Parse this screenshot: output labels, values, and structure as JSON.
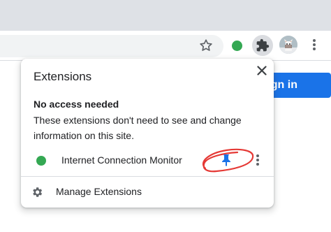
{
  "popup": {
    "title": "Extensions",
    "section_heading": "No access needed",
    "section_description": "These extensions don't need to see and change information on this site.",
    "extensions": [
      {
        "name": "Internet Connection Monitor",
        "icon": "green-dot-icon",
        "icon_color": "#34a853",
        "pinned": true
      }
    ],
    "manage_label": "Manage Extensions",
    "close_icon": "close-icon",
    "manage_icon": "gear-icon"
  },
  "page": {
    "signin_label": "gn in"
  },
  "toolbar": {
    "icons": [
      "star-icon",
      "extension-green-dot-icon",
      "puzzle-icon",
      "avatar",
      "kebab-menu-icon"
    ]
  },
  "colors": {
    "accent": "#1a73e8",
    "pin": "#1a73e8",
    "annotation": "#e53935",
    "extension_dot": "#34a853"
  }
}
